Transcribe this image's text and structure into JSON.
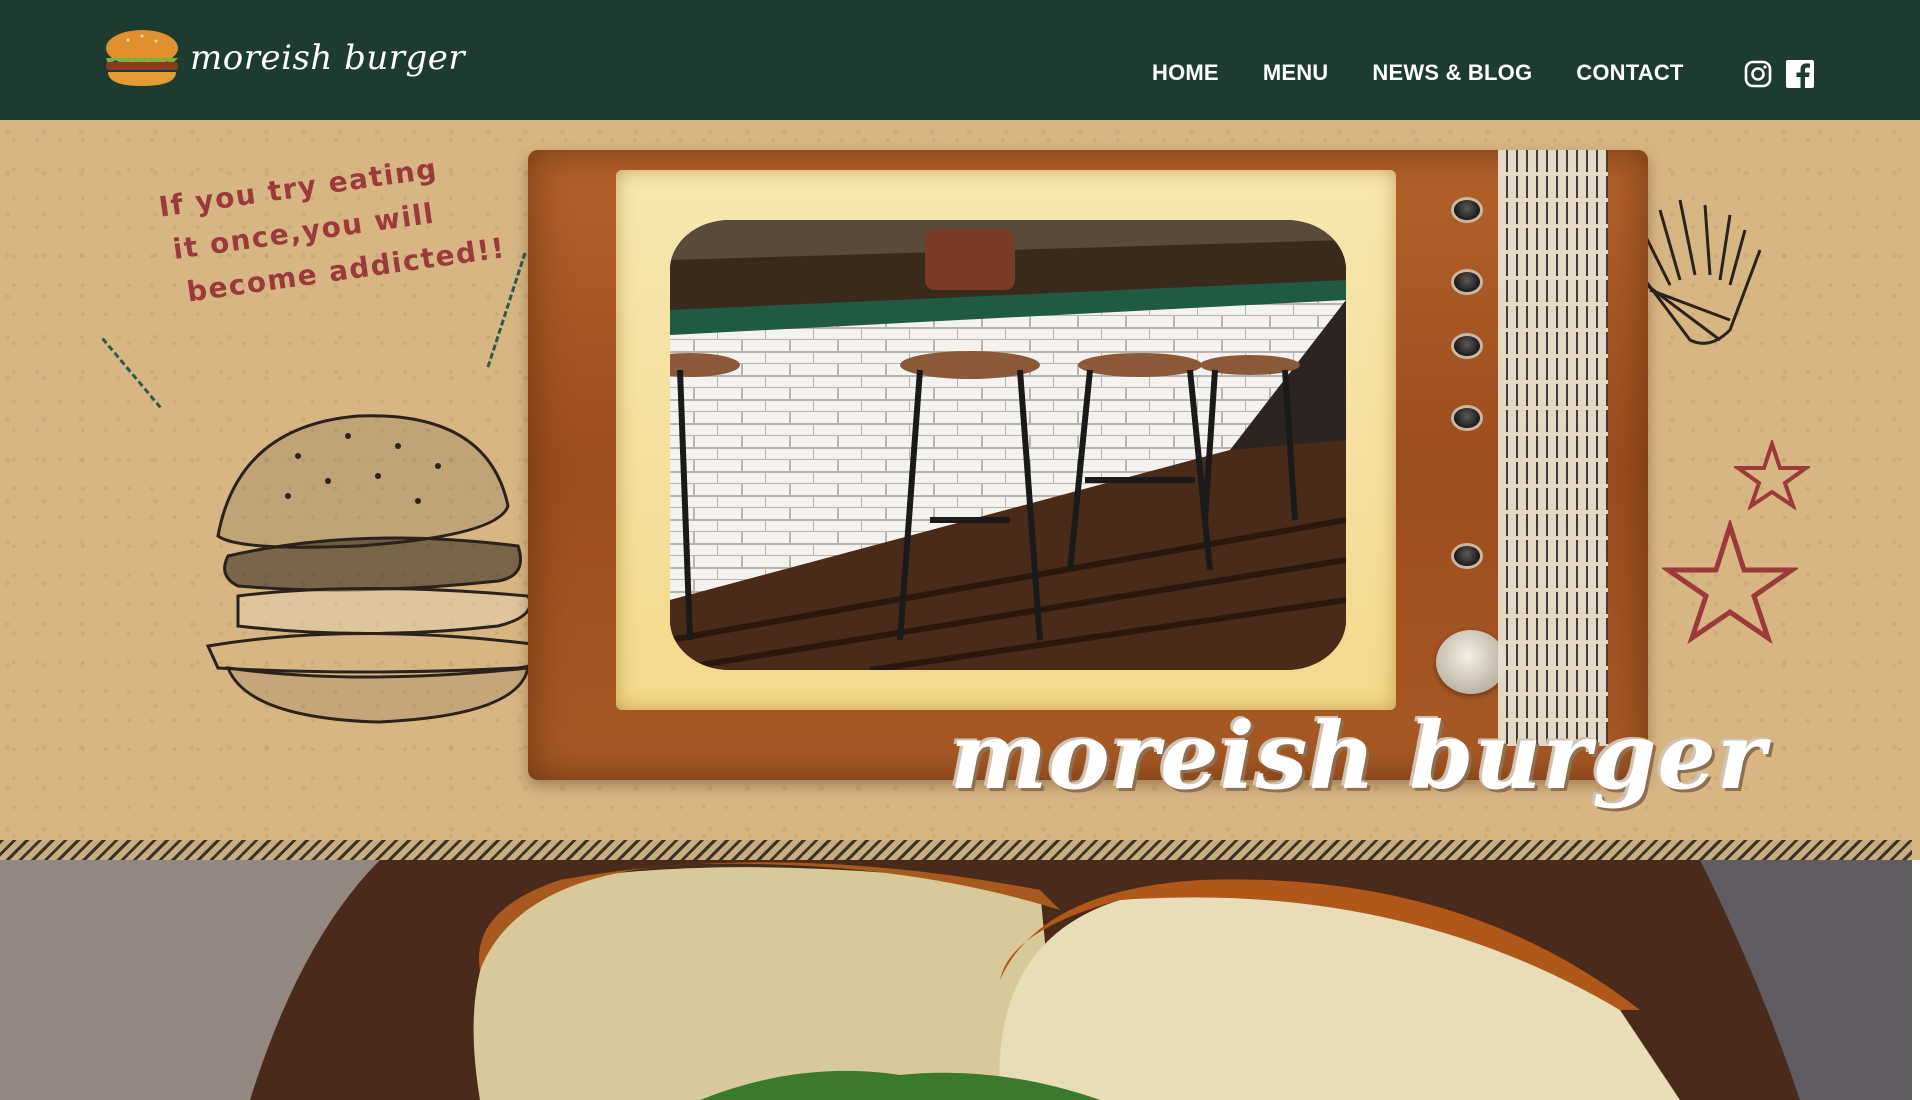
{
  "brand": {
    "name": "moreish burger"
  },
  "nav": {
    "items": [
      {
        "label": "HOME"
      },
      {
        "label": "MENU"
      },
      {
        "label": "NEWS & BLOG"
      },
      {
        "label": "CONTACT"
      }
    ]
  },
  "social": {
    "icons": [
      "instagram-icon",
      "facebook-icon"
    ]
  },
  "hero": {
    "tagline": [
      "If you try eating",
      "it once,you will",
      "become addicted!!"
    ],
    "wordmark": "moreish burger"
  },
  "colors": {
    "header_bg": "#1d3c2f",
    "hero_bg": "#d8b684",
    "tagline": "#9b3a3c",
    "tv_wood": "#a85a25"
  }
}
